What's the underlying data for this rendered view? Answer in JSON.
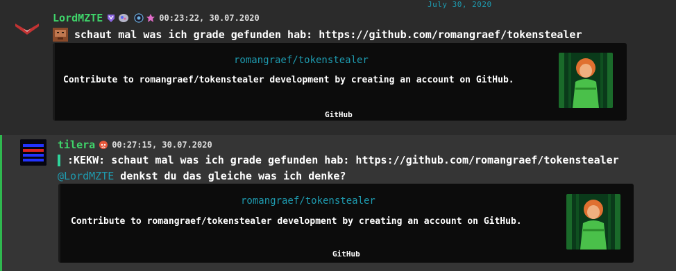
{
  "date_divider": "July 30, 2020",
  "messages": [
    {
      "username": "LordMZTE",
      "timestamp": "00:23:22, 30.07.2020",
      "text": "schaut mal was ich grade gefunden hab: https://github.com/romangraef/tokenstealer",
      "embed": {
        "title": "romangraef/tokenstealer",
        "description": "Contribute to romangraef/tokenstealer development by creating an account on GitHub.",
        "footer": "GitHub"
      }
    },
    {
      "username": "tilera",
      "timestamp": "00:27:15, 30.07.2020",
      "quote": ":KEKW: schaut mal was ich grade gefunden hab: https://github.com/romangraef/tokenstealer",
      "mention": "@LordMZTE",
      "text": " denkst du das gleiche was ich denke?",
      "embed": {
        "title": "romangraef/tokenstealer",
        "description": "Contribute to romangraef/tokenstealer development by creating an account on GitHub.",
        "footer": "GitHub"
      }
    }
  ],
  "colors": {
    "background": "#2b2b2b",
    "highlight_background": "#353535",
    "username": "#3fd46a",
    "link_title": "#1e9bb0",
    "mention": "#1e9bb0",
    "embed_background": "#0c0c0c",
    "highlight_border": "#2fb84f"
  },
  "icons": [
    "chevron-avatar-icon",
    "nitro-badge-icon",
    "booster-badge-icon",
    "server-badge-icon",
    "pink-badge-icon",
    "emoji-avatar-icon",
    "sad-face-badge-icon"
  ]
}
